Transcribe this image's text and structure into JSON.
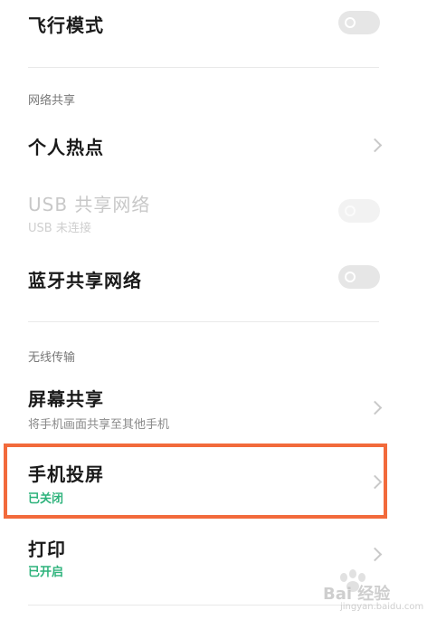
{
  "rows": {
    "airplane_mode": {
      "label": "飞行模式",
      "toggle_on": false
    },
    "network_share_header": "网络共享",
    "hotspot": {
      "label": "个人热点"
    },
    "usb_share": {
      "label": "USB 共享网络",
      "sub": "USB 未连接",
      "disabled": true,
      "toggle_on": false
    },
    "bt_share": {
      "label": "蓝牙共享网络",
      "toggle_on": false
    },
    "wireless_header": "无线传输",
    "screen_share": {
      "label": "屏幕共享",
      "sub": "将手机画面共享至其他手机"
    },
    "screen_cast": {
      "label": "手机投屏",
      "status": "已关闭"
    },
    "print": {
      "label": "打印",
      "status": "已开启"
    }
  },
  "watermark": {
    "text": "Bai 经验",
    "url": "jingyan.baidu.com"
  },
  "colors": {
    "status_green": "#2eb37c",
    "highlight_orange": "#f26a3b"
  },
  "icons": {
    "chevron": "chevron-right-icon",
    "toggle": "toggle-switch"
  }
}
